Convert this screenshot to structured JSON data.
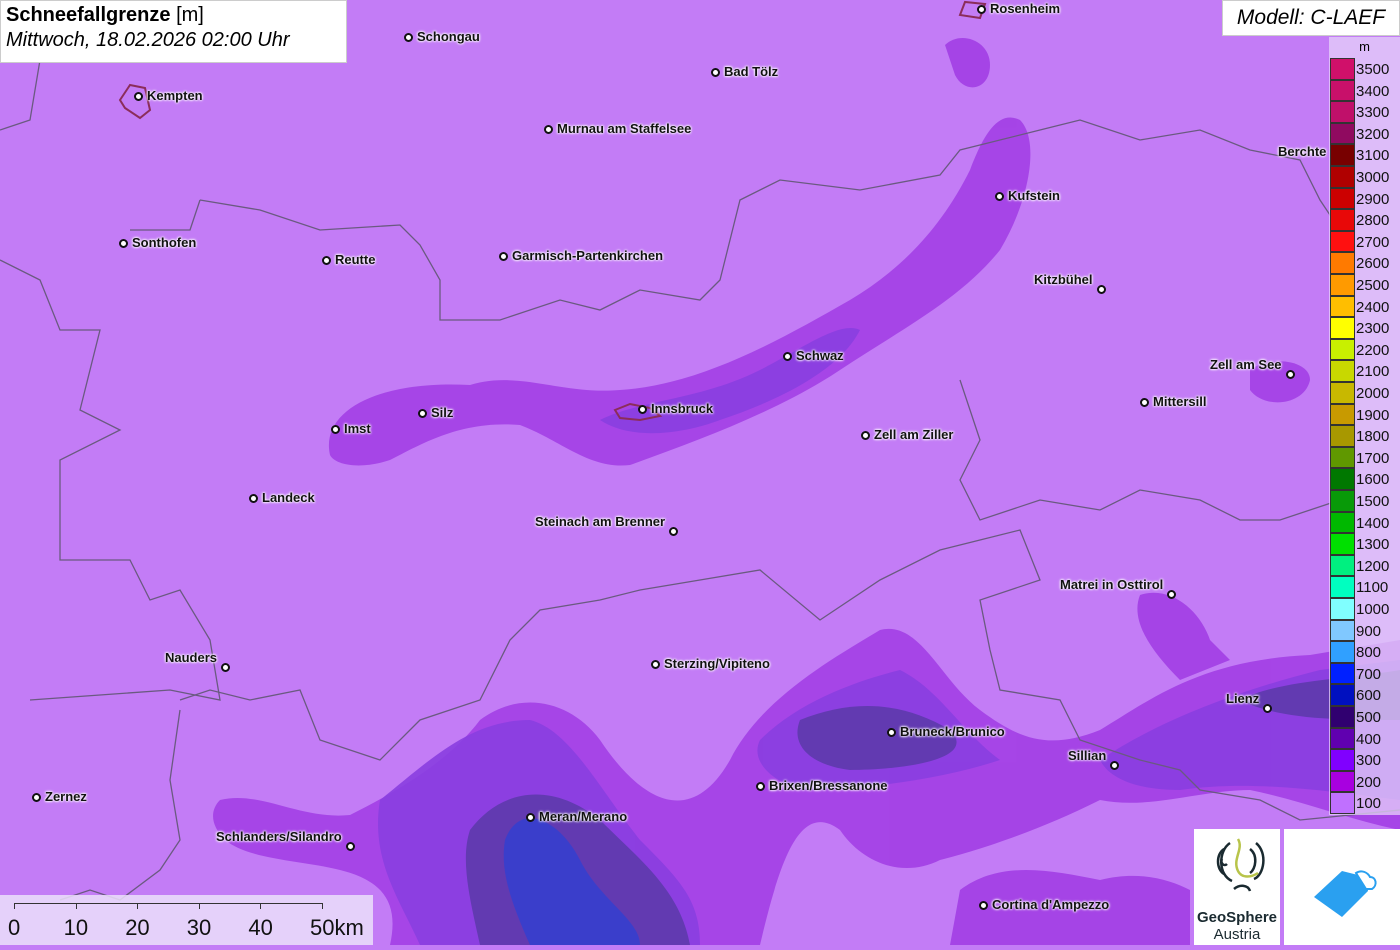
{
  "title": {
    "main": "Schneefallgrenze",
    "unit": "[m]",
    "datetime": "Mittwoch, 18.02.2026 02:00 Uhr"
  },
  "model": "Modell: C-LAEF",
  "legend": {
    "unit": "m",
    "levels": [
      {
        "label": "3500",
        "color": "#d0106a"
      },
      {
        "label": "3400",
        "color": "#c8106a"
      },
      {
        "label": "3300",
        "color": "#c0106a"
      },
      {
        "label": "3200",
        "color": "#900a60"
      },
      {
        "label": "3100",
        "color": "#780000"
      },
      {
        "label": "3000",
        "color": "#b00000"
      },
      {
        "label": "2900",
        "color": "#cc0000"
      },
      {
        "label": "2800",
        "color": "#e80808"
      },
      {
        "label": "2700",
        "color": "#ff1010"
      },
      {
        "label": "2600",
        "color": "#ff7a00"
      },
      {
        "label": "2500",
        "color": "#ff9a00"
      },
      {
        "label": "2400",
        "color": "#ffbe00"
      },
      {
        "label": "2300",
        "color": "#ffff00"
      },
      {
        "label": "2200",
        "color": "#c8f000"
      },
      {
        "label": "2100",
        "color": "#c8d800"
      },
      {
        "label": "2000",
        "color": "#c8b800"
      },
      {
        "label": "1900",
        "color": "#c89a00"
      },
      {
        "label": "1800",
        "color": "#a89800"
      },
      {
        "label": "1700",
        "color": "#609800"
      },
      {
        "label": "1600",
        "color": "#007800"
      },
      {
        "label": "1500",
        "color": "#089a08"
      },
      {
        "label": "1400",
        "color": "#00b800"
      },
      {
        "label": "1300",
        "color": "#00e000"
      },
      {
        "label": "1200",
        "color": "#00f080"
      },
      {
        "label": "1100",
        "color": "#00ffc0"
      },
      {
        "label": "1000",
        "color": "#80ffff"
      },
      {
        "label": "900",
        "color": "#80c8ff"
      },
      {
        "label": "800",
        "color": "#30a0ff"
      },
      {
        "label": "700",
        "color": "#0020ff"
      },
      {
        "label": "600",
        "color": "#0010c0"
      },
      {
        "label": "500",
        "color": "#300070"
      },
      {
        "label": "400",
        "color": "#6000b0"
      },
      {
        "label": "300",
        "color": "#8000ff"
      },
      {
        "label": "200",
        "color": "#a800e0"
      },
      {
        "label": "100",
        "color": "#c070ff"
      }
    ]
  },
  "cities": [
    "Rosenheim",
    "Schongau",
    "Kempten",
    "Bad Tölz",
    "Murnau am Staffelsee",
    "Kufstein",
    "Sonthofen",
    "Reutte",
    "Garmisch-Partenkirchen",
    "Kitzbühel",
    "Schwaz",
    "Zell am See",
    "Mittersill",
    "Silz",
    "Innsbruck",
    "Imst",
    "Zell am Ziller",
    "Landeck",
    "Steinach am Brenner",
    "Matrei in Osttirol",
    "Nauders",
    "Sterzing/Vipiteno",
    "Lienz",
    "Bruneck/Brunico",
    "Sillian",
    "Brixen/Bressanone",
    "Zernez",
    "Meran/Merano",
    "Schlanders/Silandro",
    "Cortina d'Ampezzo",
    "Berchte"
  ],
  "scalebar": {
    "labels": [
      "0",
      "10",
      "20",
      "30",
      "40",
      "50km"
    ]
  },
  "logos": {
    "geosphere_line1": "GeoSphere",
    "geosphere_line2": "Austria"
  }
}
